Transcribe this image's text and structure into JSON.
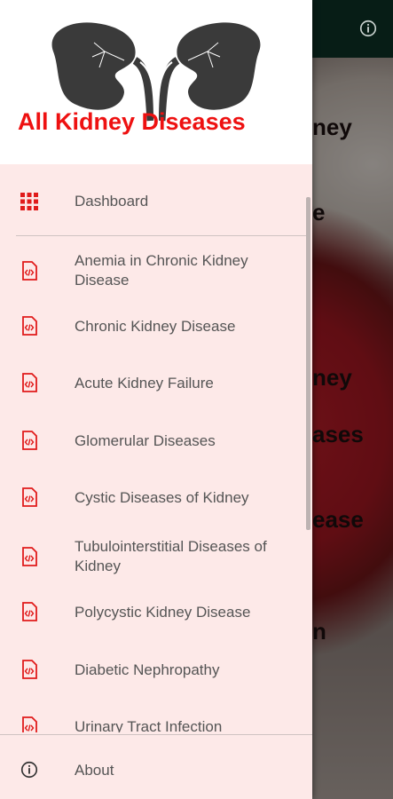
{
  "app": {
    "title": "All Kidney Diseases"
  },
  "background": {
    "fragments": [
      "ney",
      "e",
      "ney",
      "ases",
      "ease",
      "n"
    ]
  },
  "menu": {
    "dashboard": {
      "label": "Dashboard",
      "icon": "grid-icon"
    },
    "items": [
      {
        "label": "Anemia in Chronic Kidney Disease",
        "icon": "code-file-icon"
      },
      {
        "label": "Chronic Kidney Disease",
        "icon": "code-file-icon"
      },
      {
        "label": "Acute Kidney Failure",
        "icon": "code-file-icon"
      },
      {
        "label": "Glomerular Diseases",
        "icon": "code-file-icon"
      },
      {
        "label": "Cystic Diseases of Kidney",
        "icon": "code-file-icon"
      },
      {
        "label": "Tubulointerstitial Diseases of Kidney",
        "icon": "code-file-icon"
      },
      {
        "label": "Polycystic Kidney Disease",
        "icon": "code-file-icon"
      },
      {
        "label": "Diabetic Nephropathy",
        "icon": "code-file-icon"
      },
      {
        "label": "Urinary Tract Infection",
        "icon": "code-file-icon"
      }
    ],
    "about": {
      "label": "About",
      "icon": "info-icon"
    }
  },
  "colors": {
    "accent": "#ee1111",
    "drawer_bg": "#fde9e8",
    "topbar": "#0c2f25",
    "text": "#555555"
  }
}
